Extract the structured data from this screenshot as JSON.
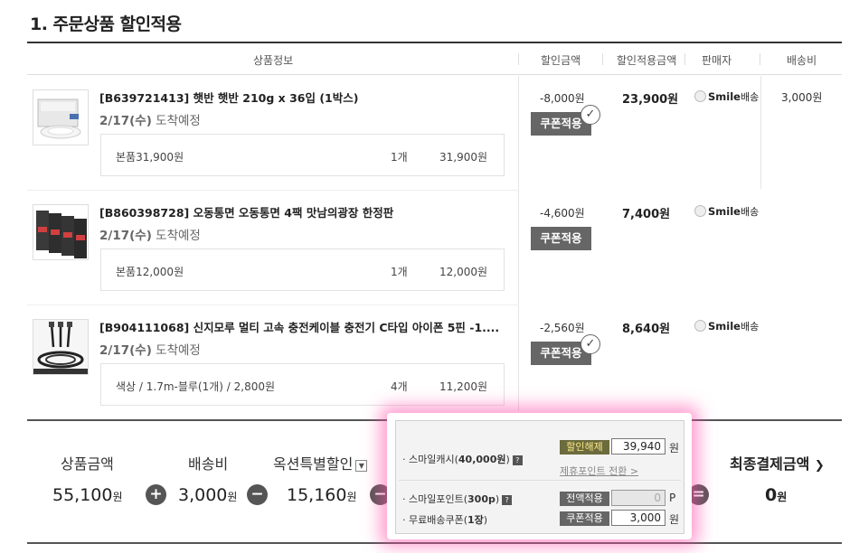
{
  "section": {
    "title": "1. 주문상품 할인적용"
  },
  "table_header": {
    "product_info": "상품정보",
    "discount_amount": "할인금액",
    "discounted_price": "할인적용금액",
    "seller": "판매자",
    "shipping": "배송비"
  },
  "products": [
    {
      "name": "[B639721413] 햇반 햇반 210g x 36입 (1박스)",
      "arrival_date": "2/17(수)",
      "arrival_text": "도착예정",
      "option": "본품31,900원",
      "qty": "1개",
      "option_price": "31,900원",
      "discount": "-8,000원",
      "coupon_label": "쿠폰적용",
      "coupon_applied": true,
      "final_amount": "23,900원",
      "seller_brand": "Smile",
      "seller_suffix": "배송",
      "shipping_fee": "3,000원"
    },
    {
      "name": "[B860398728] 오동통면 오동통면 4팩 맛남의광장 한정판",
      "arrival_date": "2/17(수)",
      "arrival_text": "도착예정",
      "option": "본품12,000원",
      "qty": "1개",
      "option_price": "12,000원",
      "discount": "-4,600원",
      "coupon_label": "쿠폰적용",
      "coupon_applied": false,
      "final_amount": "7,400원",
      "seller_brand": "Smile",
      "seller_suffix": "배송"
    },
    {
      "name": "[B904111068] 신지모루 멀티 고속 충전케이블 충전기 C타입 아이폰 5핀 -1....",
      "arrival_date": "2/17(수)",
      "arrival_text": "도착예정",
      "option": "색상 / 1.7m-블루(1개) / 2,800원",
      "qty": "4개",
      "option_price": "11,200원",
      "discount": "-2,560원",
      "coupon_label": "쿠폰적용",
      "coupon_applied": true,
      "final_amount": "8,640원",
      "seller_brand": "Smile",
      "seller_suffix": "배송"
    }
  ],
  "summary": {
    "product_total_label": "상품금액",
    "product_total": "55,100",
    "shipping_label": "배송비",
    "shipping": "3,000",
    "auction_discount_label": "옥션특별할인",
    "auction_discount": "15,160",
    "final_label": "최종결제금액",
    "final": "0",
    "currency": "원"
  },
  "popup": {
    "smile_cash_label_pre": "스마일캐시(",
    "smile_cash_amount": "40,000원",
    "smile_cash_label_post": ")",
    "smile_cash_btn": "할인해제",
    "smile_cash_value": "39,940",
    "smile_cash_unit": "원",
    "partner_point_link": "제휴포인트 전환 >",
    "smile_point_label_pre": "스마일포인트(",
    "smile_point_amount": "300p",
    "smile_point_label_post": ")",
    "smile_point_btn": "전액적용",
    "smile_point_value": "0",
    "smile_point_unit": "P",
    "free_ship_label_pre": "무료배송쿠폰(",
    "free_ship_count": "1장",
    "free_ship_label_post": ")",
    "free_ship_btn": "쿠폰적용",
    "free_ship_value": "3,000",
    "free_ship_unit": "원"
  },
  "colors": {
    "popup_glow": "#ff50aa",
    "button_gray": "#666666"
  }
}
